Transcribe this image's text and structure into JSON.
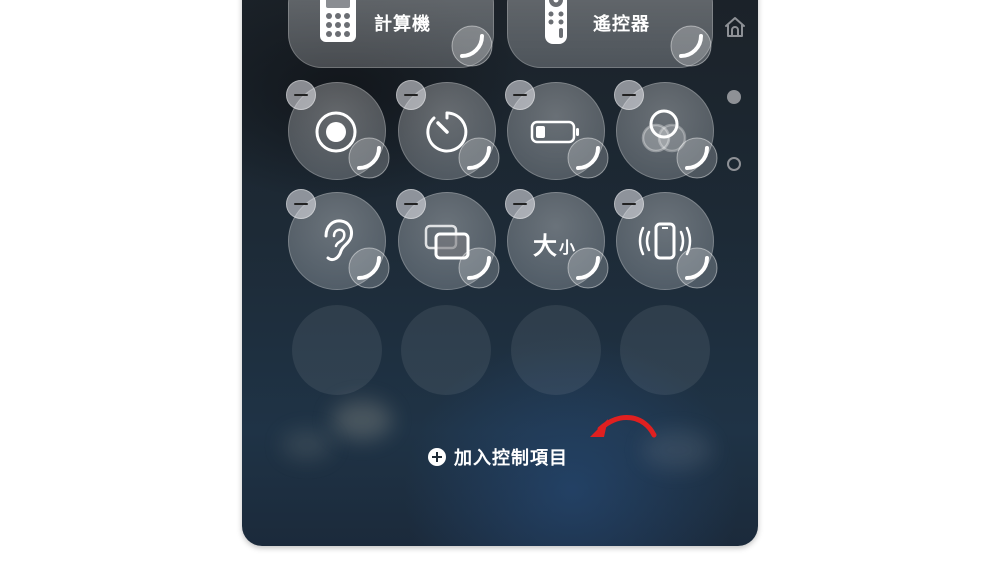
{
  "wide_controls": [
    {
      "label": "計算機",
      "icon": "calculator-icon"
    },
    {
      "label": "遙控器",
      "icon": "remote-icon"
    }
  ],
  "tiles_row1": [
    "screen-recording-icon",
    "timer-icon",
    "low-power-mode-icon",
    "dark-mode-icon"
  ],
  "tiles_row2": [
    "hearing-icon",
    "screen-mirroring-icon",
    "text-size-icon",
    "vibration-icon"
  ],
  "text_size_label": {
    "big": "大",
    "small": "小"
  },
  "add_controls": {
    "label": "加入控制項目"
  },
  "side_icons": [
    "home-icon",
    "page-dot-filled-icon",
    "page-dot-empty-icon"
  ],
  "annotation": {
    "arrow_color": "#e02020"
  }
}
